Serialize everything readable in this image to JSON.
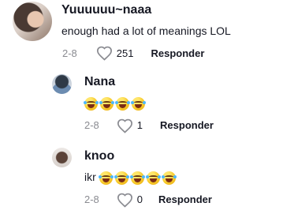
{
  "comments": [
    {
      "username": "Yuuuuuu~naaa",
      "text": "enough had a lot of meanings LOL",
      "date": "2-8",
      "likes": "251",
      "reply_label": "Responder"
    },
    {
      "username": "Nana",
      "text": "",
      "emoji_count": 4,
      "date": "2-8",
      "likes": "1",
      "reply_label": "Responder"
    },
    {
      "username": "knoo",
      "text": "ikr",
      "emoji_count": 5,
      "date": "2-8",
      "likes": "0",
      "reply_label": "Responder"
    }
  ],
  "icons": {
    "heart": "heart-icon",
    "emoji": "face-with-tears-of-joy-icon"
  }
}
